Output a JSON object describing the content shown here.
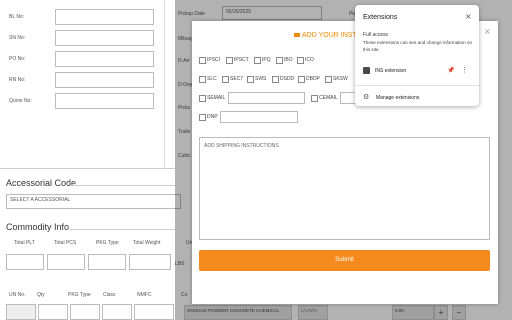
{
  "left_form": {
    "fields": [
      {
        "label": "BL No:"
      },
      {
        "label": "SN No:"
      },
      {
        "label": "PO No:"
      },
      {
        "label": "RN No:"
      },
      {
        "label": "Quote No:"
      }
    ]
  },
  "accessorial": {
    "title": "Accessorial Code",
    "placeholder": "SELECT A ACCESSORIAL"
  },
  "commodity": {
    "title": "Commodity Info.",
    "headers": [
      "Total PLT",
      "Total PCS",
      "PKG Type",
      "Total Weight",
      "Un"
    ],
    "unit": "LBS",
    "headers2": [
      "UN No.",
      "Qty",
      "PKG Type",
      "Class",
      "NMFC",
      "Co"
    ]
  },
  "background_right": {
    "pickup_date_label": "Pickup Date",
    "pickup_date_value": "05/26/2025",
    "side_labels": [
      "Mileag",
      "D-Arr",
      "D-Dep",
      "Picku",
      "Traile",
      "Cubic"
    ],
    "top_right_label": "Pie",
    "desc": "VARIOUS POWDER CONCRETE CHEMICAL",
    "lwh_placeholder": "L/L/W/H",
    "amount": "0.00"
  },
  "modal": {
    "title": "ADD YOUR INSTRUC",
    "checkbox_row1": [
      "IPSCI",
      "IPSCT",
      "IPQ",
      "IBO",
      "ICO"
    ],
    "checkbox_row2": [
      "SLC",
      "SEC7",
      "SWS",
      "DSDD",
      "DBDP",
      "SKSW"
    ],
    "semail_label": "SEMAIL",
    "cemail_label": "CEMAIL",
    "dnp_label": "DNP",
    "textarea_placeholder": "ADD SHIPPING INSTRUCTIONS",
    "submit_label": "Submit",
    "close": "×"
  },
  "extensions_popup": {
    "title": "Extensions",
    "close": "×",
    "section": "Full access",
    "description": "These extensions can see and change information on this site.",
    "extension_name": "INS extension",
    "manage_label": "Manage extensions"
  }
}
